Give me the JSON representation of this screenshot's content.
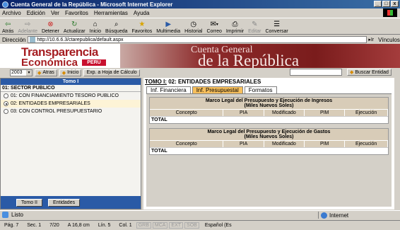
{
  "window": {
    "title": "Cuenta General de la República - Microsoft Internet Explorer",
    "buttons": [
      "_",
      "□",
      "x"
    ]
  },
  "menu": [
    "Archivo",
    "Edición",
    "Ver",
    "Favoritos",
    "Herramientas",
    "Ayuda"
  ],
  "toolbar": [
    {
      "label": "Atrás",
      "icon": "back-arrow-icon",
      "enabled": true
    },
    {
      "label": "Adelante",
      "icon": "forward-arrow-icon",
      "enabled": false
    },
    {
      "label": "Detener",
      "icon": "stop-icon",
      "enabled": true
    },
    {
      "label": "Actualizar",
      "icon": "refresh-icon",
      "enabled": true
    },
    {
      "label": "Inicio",
      "icon": "home-icon",
      "enabled": true
    },
    {
      "label": "Búsqueda",
      "icon": "search-icon",
      "enabled": true
    },
    {
      "label": "Favoritos",
      "icon": "favorites-icon",
      "enabled": true
    },
    {
      "label": "Multimedia",
      "icon": "media-icon",
      "enabled": true
    },
    {
      "label": "Historial",
      "icon": "history-icon",
      "enabled": true
    },
    {
      "label": "Correo",
      "icon": "mail-icon",
      "enabled": true
    },
    {
      "label": "Imprimir",
      "icon": "print-icon",
      "enabled": true
    },
    {
      "label": "Editar",
      "icon": "edit-icon",
      "enabled": false
    },
    {
      "label": "Conversar",
      "icon": "discuss-icon",
      "enabled": true
    }
  ],
  "address": {
    "label": "Dirección",
    "url": "http://10.6.6.3/ctarepublica/default.aspx",
    "go": "Ir",
    "links": "Vínculos"
  },
  "banner": {
    "logo_line1": "Transparencia",
    "logo_line2": "Económica",
    "logo_badge": "PERU",
    "title_line1": "Cuenta General",
    "title_line2": "de la República"
  },
  "nav": {
    "year": "2003",
    "back": "Atras",
    "home": "Inicio",
    "export": "Exp. a Hoja de Cálculo",
    "search_button": "Buscar Entidad",
    "search_value": ""
  },
  "left": {
    "header": "Tomo I",
    "sector": "01: SECTOR PUBLICO",
    "options": [
      {
        "label": "01: CON FINANCIAMIENTO TESORO PUBLICO",
        "selected": false
      },
      {
        "label": "02: ENTIDADES EMPRESARIALES",
        "selected": true
      },
      {
        "label": "03: CON CONTROL PRESUPUESTARIO",
        "selected": false
      }
    ],
    "buttons": [
      "Tomo II",
      "Entidades"
    ]
  },
  "right": {
    "tomo_prefix": "TOMO I:",
    "tomo_title": "02: ENTIDADES EMPRESARIALES",
    "tabs": [
      {
        "label": "Inf. Financiera",
        "active": false
      },
      {
        "label": "Inf. Presupuestal",
        "active": true
      },
      {
        "label": "Formatos",
        "active": false
      }
    ],
    "tables": [
      {
        "title": "Marco Legal del Presupuesto y Ejecución de Ingresos",
        "subtitle": "(Miles Nuevos Soles)",
        "columns": [
          "Concepto",
          "PIA",
          "Modificado",
          "PIM",
          "Ejecución"
        ],
        "total_label": "TOTAL"
      },
      {
        "title": "Marco Legal del Presupuesto y Ejecución de Gastos",
        "subtitle": "(Miles Nuevos Soles)",
        "columns": [
          "Concepto",
          "PIA",
          "Modificado",
          "PIM",
          "Ejecución"
        ],
        "total_label": "TOTAL"
      }
    ]
  },
  "status": {
    "text": "Listo",
    "zone": "Internet"
  },
  "wordstatus": [
    "Pág.  7",
    "Sec.  1",
    "7/20",
    "A  16,8 cm",
    "Lín.  5",
    "Col.  1",
    "GRB",
    "MCA",
    "EXT",
    "SOB",
    "Español (Es"
  ]
}
